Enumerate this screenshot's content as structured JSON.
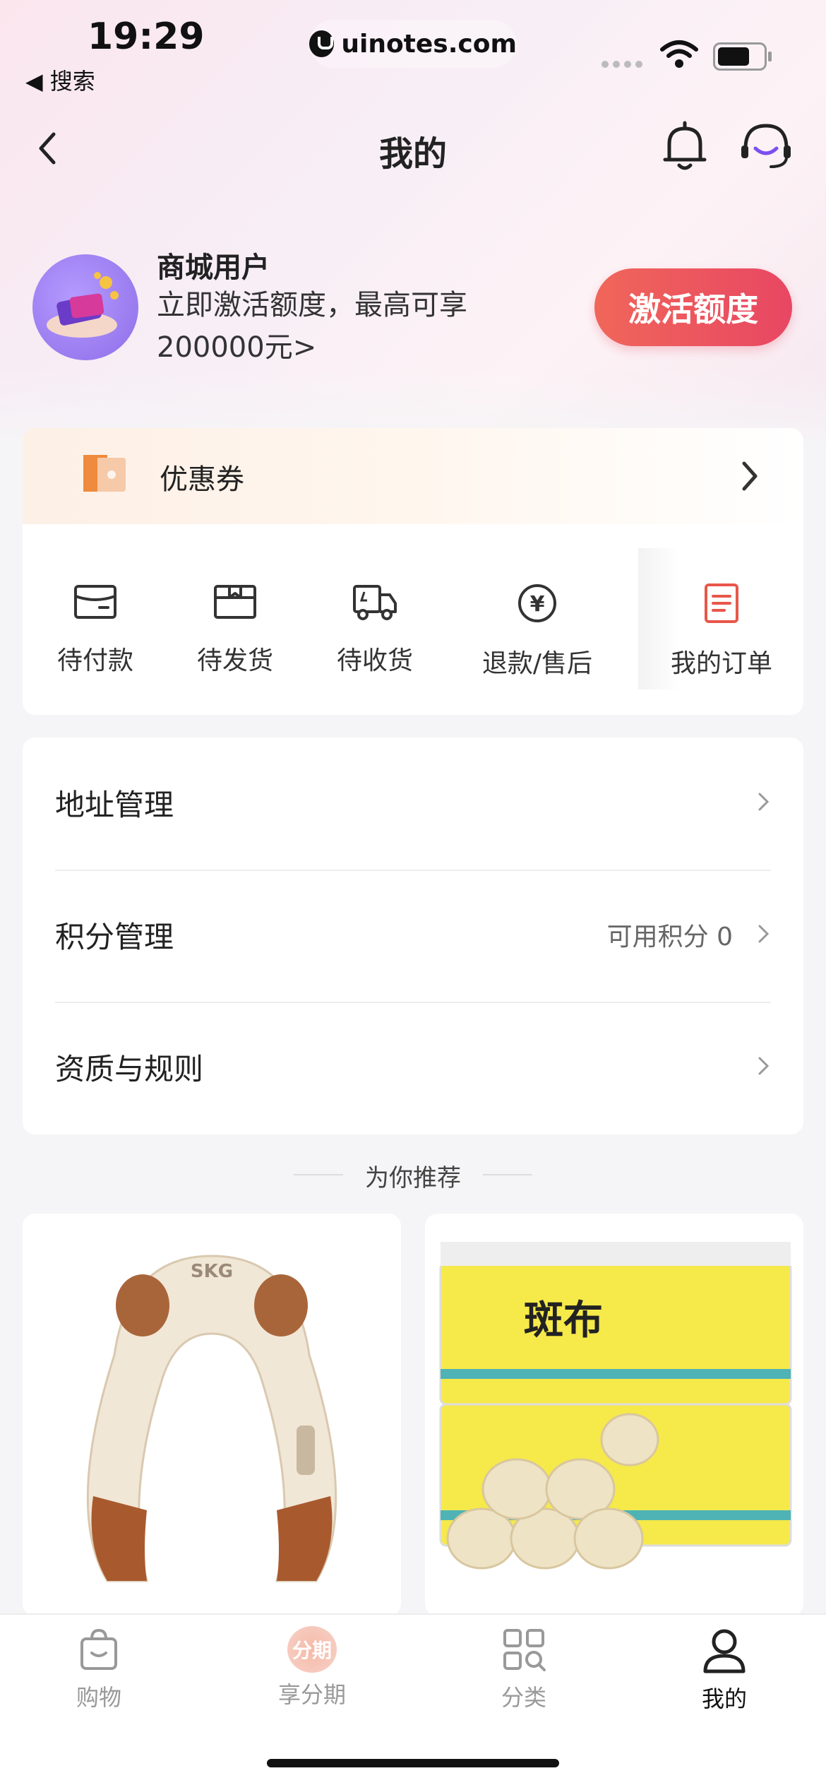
{
  "status_bar": {
    "time": "19:29",
    "back_app": "◀ 搜索",
    "url": "uinotes.com"
  },
  "nav": {
    "title": "我的"
  },
  "profile": {
    "username": "商城用户",
    "promo_line1": "立即激活额度，最高可享",
    "promo_line2": "200000元>",
    "activate_button": "激活额度"
  },
  "coupon": {
    "label": "优惠券"
  },
  "orders": [
    {
      "label": "待付款",
      "icon": "wallet-icon"
    },
    {
      "label": "待发货",
      "icon": "box-icon"
    },
    {
      "label": "待收货",
      "icon": "truck-icon"
    },
    {
      "label": "退款/售后",
      "icon": "yen-icon"
    },
    {
      "label": "我的订单",
      "icon": "order-list-icon"
    }
  ],
  "menu": [
    {
      "label": "地址管理",
      "value": ""
    },
    {
      "label": "积分管理",
      "value": "可用积分 0"
    },
    {
      "label": "资质与规则",
      "value": ""
    }
  ],
  "recommend": {
    "title": "为你推荐"
  },
  "products": [
    {
      "image": "shoulder-massager-image",
      "logo": "SKG"
    },
    {
      "image": "paper-towel-pack-image",
      "logo": "斑布"
    }
  ],
  "tabs": [
    {
      "label": "购物",
      "icon": "bag-icon"
    },
    {
      "label": "享分期",
      "icon": "installment-icon",
      "badge": "分期"
    },
    {
      "label": "分类",
      "icon": "category-icon"
    },
    {
      "label": "我的",
      "icon": "user-icon",
      "active": true
    }
  ],
  "colors": {
    "accent": "#e84763",
    "order_highlight": "#e8574a",
    "icon_dark": "#333333"
  }
}
